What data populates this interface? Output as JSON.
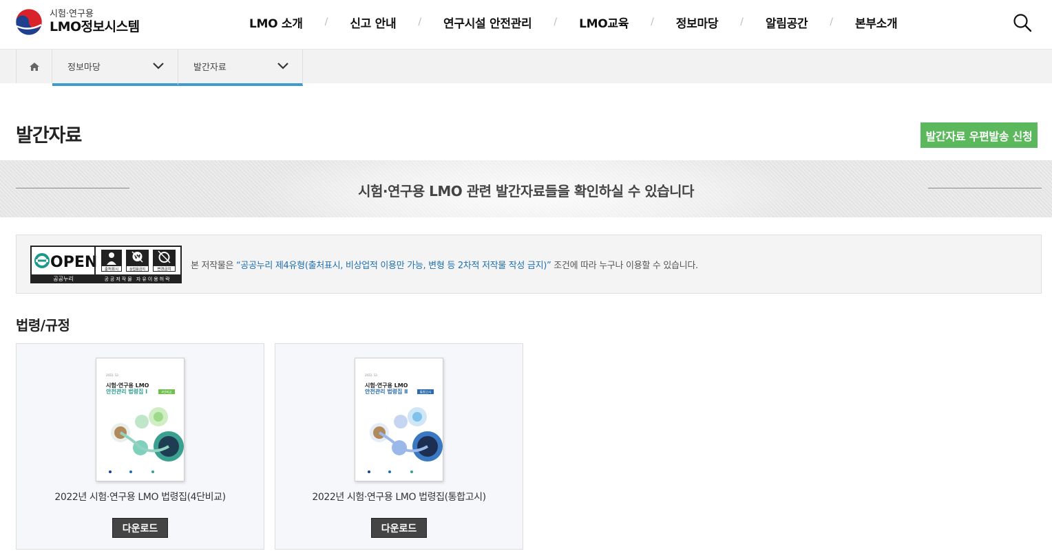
{
  "header": {
    "logo_sub": "시험·연구용",
    "logo_main": "LMO정보시스템",
    "nav": [
      "LMO 소개",
      "신고 안내",
      "연구시설 안전관리",
      "LMO교육",
      "정보마당",
      "알림공간",
      "본부소개"
    ],
    "separator": "/",
    "icons": {
      "logo": "taegeuk-logo-icon",
      "search": "search-icon"
    }
  },
  "breadcrumb": {
    "home_icon": "home-icon",
    "level1": "정보마당",
    "level2": "발간자료",
    "accent": "#3d9bd1"
  },
  "page": {
    "title": "발간자료",
    "mail_button": "발간자료 우편발송 신청",
    "mail_button_color": "#5cb85c"
  },
  "banner": {
    "text": "시험·연구용 LMO 관련 발간자료들을 확인하실 수 있습니다"
  },
  "license": {
    "badge": {
      "open": "OPEN",
      "name": "공공누리",
      "slogan": "공공저작물 자유이용허락",
      "labels": [
        "출처표시",
        "상업용금지",
        "변경금지"
      ]
    },
    "text_before": "본 저작물은 ",
    "text_highlight": "“공공누리 제4유형(출처표시, 비상업적 이용만 가능, 변형 등 2차적 저작물 작성 금지)”",
    "text_after": " 조건에 따라 누구나 이용할 수 있습니다."
  },
  "section": {
    "title": "법령/규정",
    "items": [
      {
        "title": "2022년 시험·연구용 LMO 법령집(4단비교)",
        "download": "다운로드",
        "cover_year": "2022. 12.",
        "cover_line1": "시험·연구용 LMO",
        "cover_line2": "안전관리 법령집 Ⅰ",
        "cover_tag": "4단비교",
        "cover_color": "#2a9d8f",
        "cover_tag_color": "#6fbf4b"
      },
      {
        "title": "2022년 시험·연구용 LMO 법령집(통합고시)",
        "download": "다운로드",
        "cover_year": "2022. 12.",
        "cover_line1": "시험·연구용 LMO",
        "cover_line2": "안전관리 법령집 Ⅱ",
        "cover_tag": "통합고시",
        "cover_color": "#2b6cb0",
        "cover_tag_color": "#2b6cb0"
      }
    ]
  }
}
